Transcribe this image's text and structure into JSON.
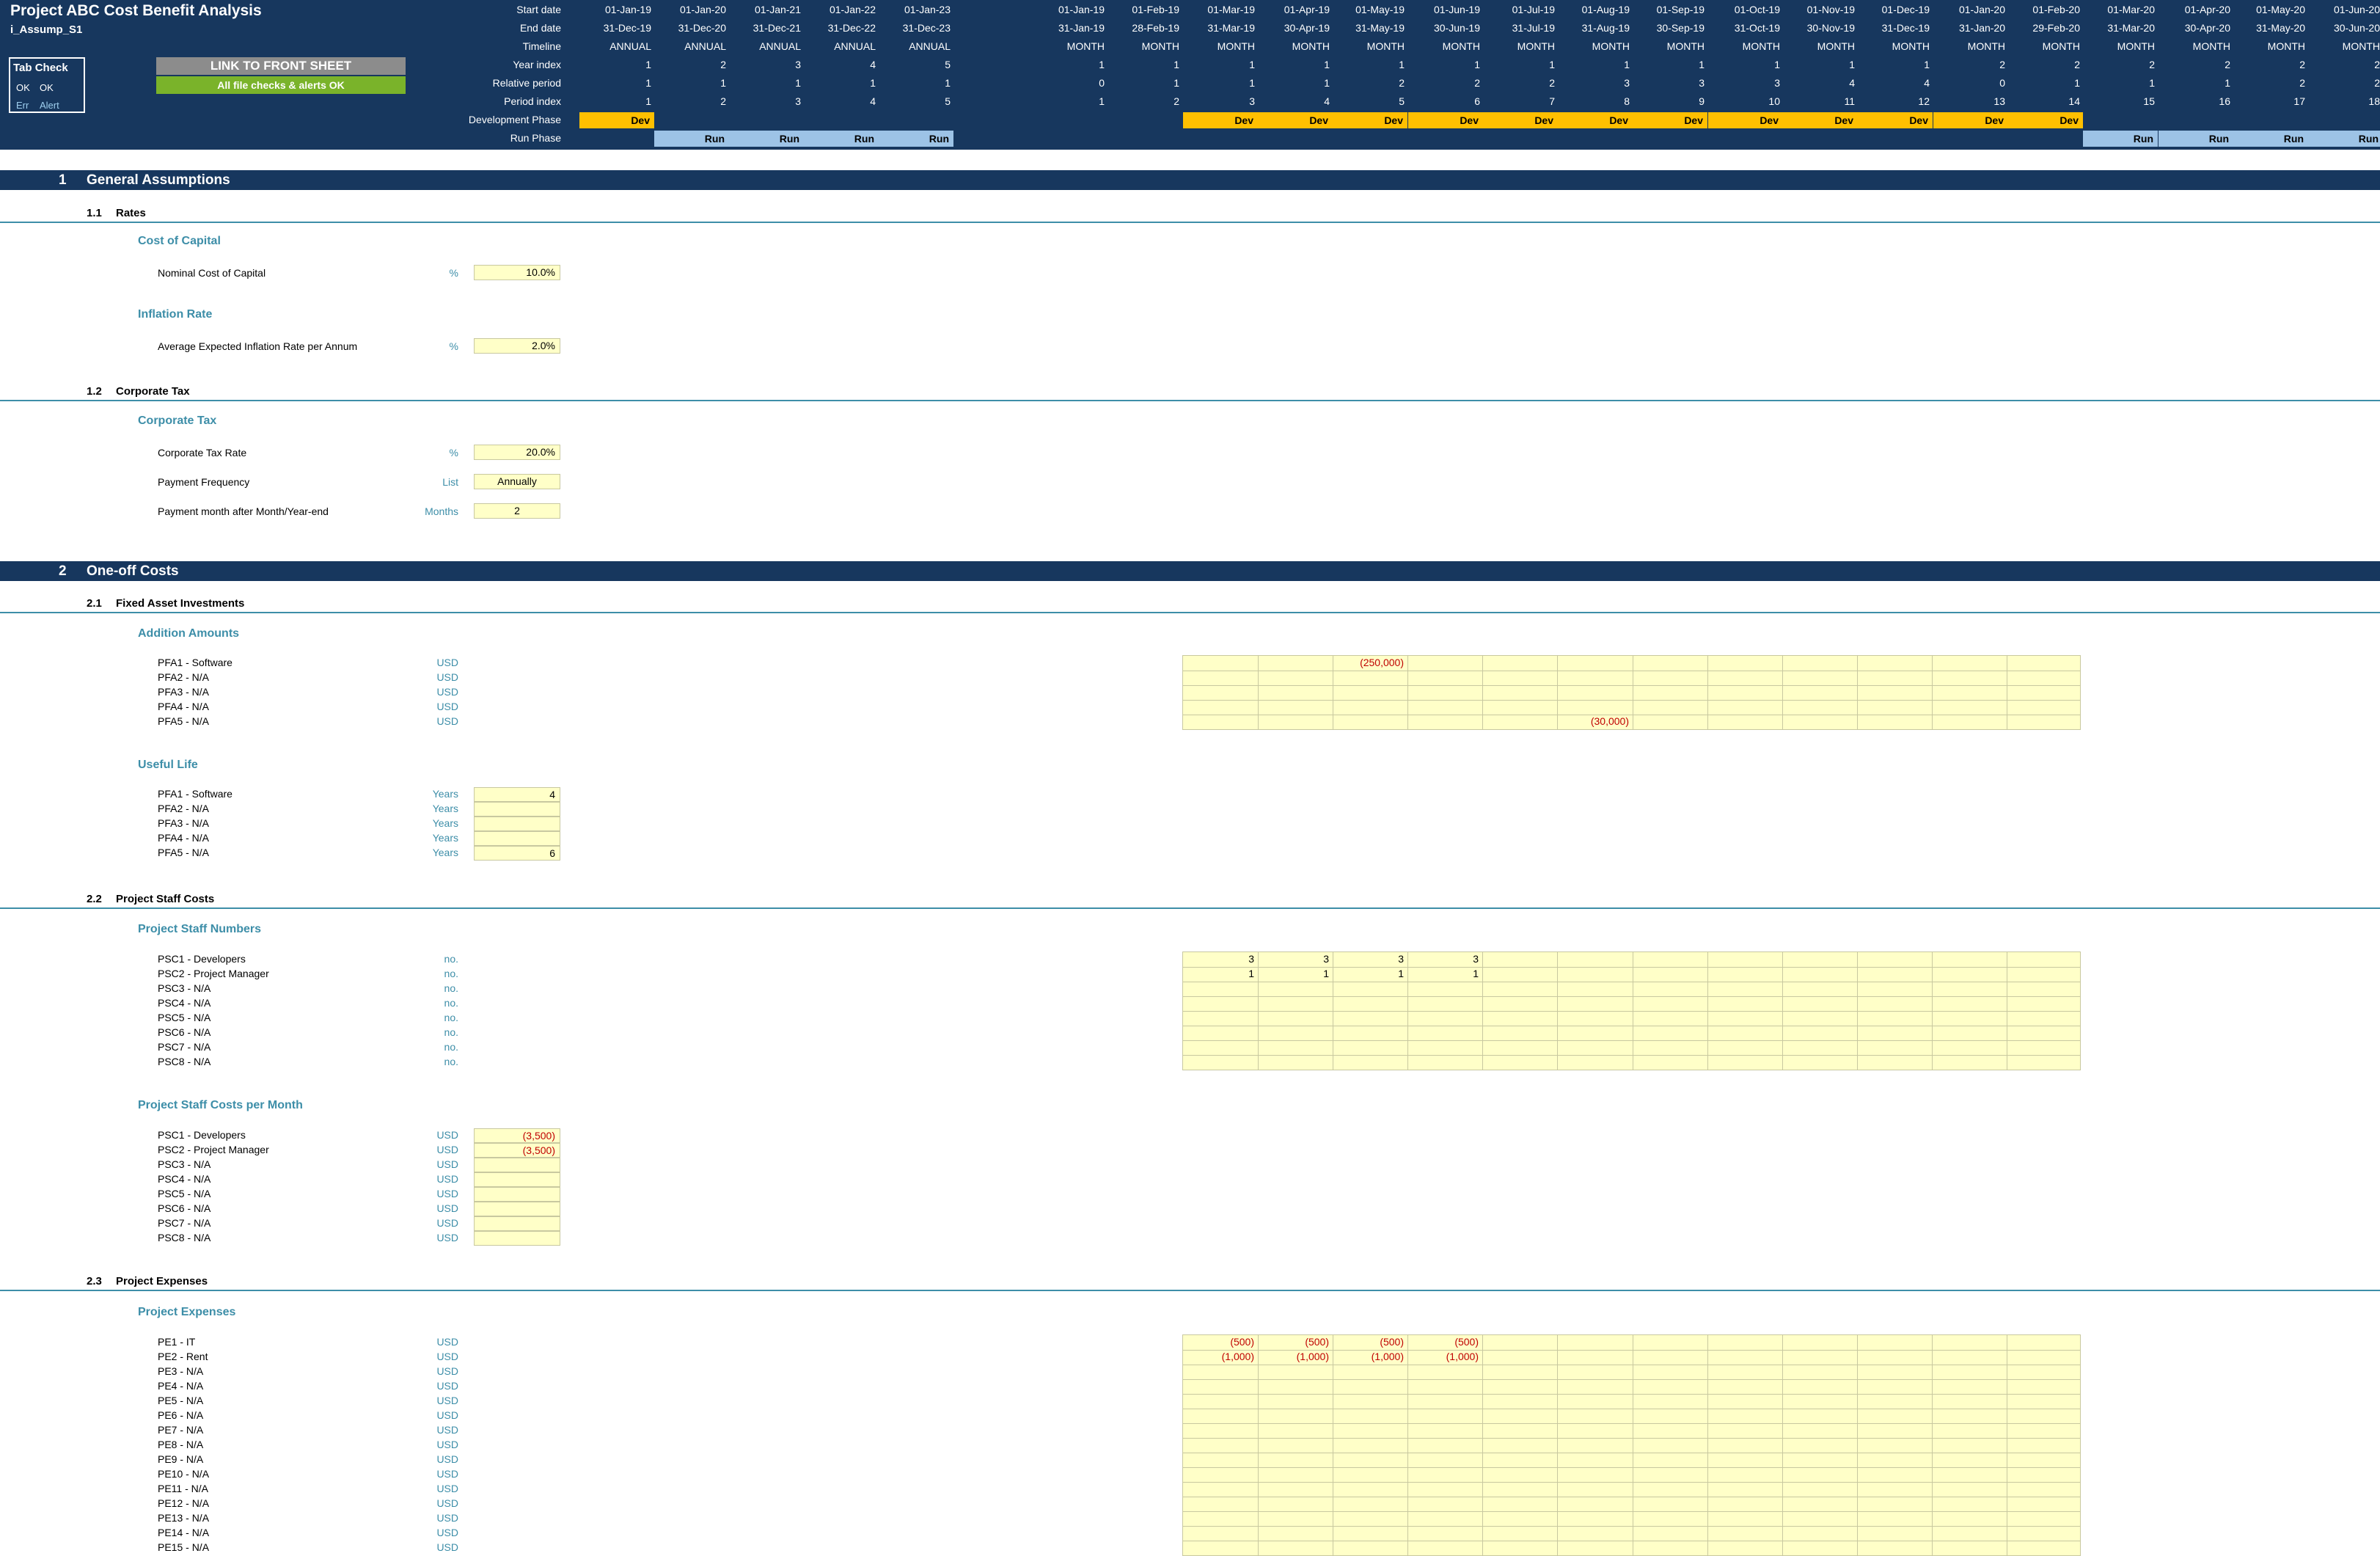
{
  "header": {
    "title": "Project ABC Cost Benefit Analysis",
    "sheet_name": "i_Assump_S1",
    "tab_check": {
      "title": "Tab Check",
      "ok1": "OK",
      "ok2": "OK",
      "err": "Err",
      "alert": "Alert"
    },
    "link_button": "LINK TO FRONT SHEET",
    "checks_status": "All file checks & alerts OK",
    "row_labels": {
      "start_date": "Start date",
      "end_date": "End date",
      "timeline": "Timeline",
      "year_index": "Year index",
      "relative_period": "Relative period",
      "period_index": "Period index",
      "development_phase": "Development Phase",
      "run_phase": "Run Phase"
    },
    "annual_columns": [
      {
        "start": "01-Jan-19",
        "end": "31-Dec-19",
        "timeline": "ANNUAL",
        "year_index": "1",
        "relative": "1",
        "period": "1",
        "dev": "Dev",
        "run": ""
      },
      {
        "start": "01-Jan-20",
        "end": "31-Dec-20",
        "timeline": "ANNUAL",
        "year_index": "2",
        "relative": "1",
        "period": "2",
        "dev": "",
        "run": "Run"
      },
      {
        "start": "01-Jan-21",
        "end": "31-Dec-21",
        "timeline": "ANNUAL",
        "year_index": "3",
        "relative": "1",
        "period": "3",
        "dev": "",
        "run": "Run"
      },
      {
        "start": "01-Jan-22",
        "end": "31-Dec-22",
        "timeline": "ANNUAL",
        "year_index": "4",
        "relative": "1",
        "period": "4",
        "dev": "",
        "run": "Run"
      },
      {
        "start": "01-Jan-23",
        "end": "31-Dec-23",
        "timeline": "ANNUAL",
        "year_index": "5",
        "relative": "1",
        "period": "5",
        "dev": "",
        "run": "Run"
      }
    ],
    "monthly_columns": [
      {
        "start": "01-Jan-19",
        "end": "31-Jan-19",
        "timeline": "MONTH",
        "year_index": "1",
        "relative": "0",
        "period": "1",
        "dev": "",
        "run": ""
      },
      {
        "start": "01-Feb-19",
        "end": "28-Feb-19",
        "timeline": "MONTH",
        "year_index": "1",
        "relative": "1",
        "period": "2",
        "dev": "",
        "run": ""
      },
      {
        "start": "01-Mar-19",
        "end": "31-Mar-19",
        "timeline": "MONTH",
        "year_index": "1",
        "relative": "1",
        "period": "3",
        "dev": "Dev",
        "run": ""
      },
      {
        "start": "01-Apr-19",
        "end": "30-Apr-19",
        "timeline": "MONTH",
        "year_index": "1",
        "relative": "1",
        "period": "4",
        "dev": "Dev",
        "run": ""
      },
      {
        "start": "01-May-19",
        "end": "31-May-19",
        "timeline": "MONTH",
        "year_index": "1",
        "relative": "2",
        "period": "5",
        "dev": "Dev",
        "run": ""
      },
      {
        "start": "01-Jun-19",
        "end": "30-Jun-19",
        "timeline": "MONTH",
        "year_index": "1",
        "relative": "2",
        "period": "6",
        "dev": "Dev",
        "run": ""
      },
      {
        "start": "01-Jul-19",
        "end": "31-Jul-19",
        "timeline": "MONTH",
        "year_index": "1",
        "relative": "2",
        "period": "7",
        "dev": "Dev",
        "run": ""
      },
      {
        "start": "01-Aug-19",
        "end": "31-Aug-19",
        "timeline": "MONTH",
        "year_index": "1",
        "relative": "3",
        "period": "8",
        "dev": "Dev",
        "run": ""
      },
      {
        "start": "01-Sep-19",
        "end": "30-Sep-19",
        "timeline": "MONTH",
        "year_index": "1",
        "relative": "3",
        "period": "9",
        "dev": "Dev",
        "run": ""
      },
      {
        "start": "01-Oct-19",
        "end": "31-Oct-19",
        "timeline": "MONTH",
        "year_index": "1",
        "relative": "3",
        "period": "10",
        "dev": "Dev",
        "run": ""
      },
      {
        "start": "01-Nov-19",
        "end": "30-Nov-19",
        "timeline": "MONTH",
        "year_index": "1",
        "relative": "4",
        "period": "11",
        "dev": "Dev",
        "run": ""
      },
      {
        "start": "01-Dec-19",
        "end": "31-Dec-19",
        "timeline": "MONTH",
        "year_index": "1",
        "relative": "4",
        "period": "12",
        "dev": "Dev",
        "run": ""
      },
      {
        "start": "01-Jan-20",
        "end": "31-Jan-20",
        "timeline": "MONTH",
        "year_index": "2",
        "relative": "0",
        "period": "13",
        "dev": "Dev",
        "run": ""
      },
      {
        "start": "01-Feb-20",
        "end": "29-Feb-20",
        "timeline": "MONTH",
        "year_index": "2",
        "relative": "1",
        "period": "14",
        "dev": "Dev",
        "run": ""
      },
      {
        "start": "01-Mar-20",
        "end": "31-Mar-20",
        "timeline": "MONTH",
        "year_index": "2",
        "relative": "1",
        "period": "15",
        "dev": "",
        "run": "Run"
      },
      {
        "start": "01-Apr-20",
        "end": "30-Apr-20",
        "timeline": "MONTH",
        "year_index": "2",
        "relative": "1",
        "period": "16",
        "dev": "",
        "run": "Run"
      },
      {
        "start": "01-May-20",
        "end": "31-May-20",
        "timeline": "MONTH",
        "year_index": "2",
        "relative": "2",
        "period": "17",
        "dev": "",
        "run": "Run"
      },
      {
        "start": "01-Jun-20",
        "end": "30-Jun-20",
        "timeline": "MONTH",
        "year_index": "2",
        "relative": "2",
        "period": "18",
        "dev": "",
        "run": "Run"
      }
    ]
  },
  "sections": {
    "s1": {
      "num": "1",
      "title": "General Assumptions"
    },
    "s1_1": {
      "num": "1.1",
      "title": "Rates"
    },
    "cost_of_capital": {
      "group": "Cost of Capital",
      "label": "Nominal Cost of Capital",
      "unit": "%",
      "value": "10.0%"
    },
    "inflation": {
      "group": "Inflation Rate",
      "label": "Average Expected Inflation Rate per Annum",
      "unit": "%",
      "value": "2.0%"
    },
    "s1_2": {
      "num": "1.2",
      "title": "Corporate Tax"
    },
    "corp_tax": {
      "group": "Corporate Tax",
      "rate_label": "Corporate Tax Rate",
      "rate_unit": "%",
      "rate_value": "20.0%",
      "freq_label": "Payment Frequency",
      "freq_unit": "List",
      "freq_value": "Annually",
      "month_label": "Payment month after Month/Year-end",
      "month_unit": "Months",
      "month_value": "2"
    },
    "s2": {
      "num": "2",
      "title": "One-off Costs"
    },
    "s2_1": {
      "num": "2.1",
      "title": "Fixed Asset Investments"
    },
    "addition_amounts": {
      "group": "Addition Amounts",
      "unit": "USD",
      "rows": [
        {
          "label": "PFA1 - Software",
          "values": [
            "",
            "",
            "(250,000)",
            "",
            "",
            "",
            "",
            "",
            "",
            "",
            "",
            ""
          ]
        },
        {
          "label": "PFA2 - N/A",
          "values": [
            "",
            "",
            "",
            "",
            "",
            "",
            "",
            "",
            "",
            "",
            "",
            ""
          ]
        },
        {
          "label": "PFA3 - N/A",
          "values": [
            "",
            "",
            "",
            "",
            "",
            "",
            "",
            "",
            "",
            "",
            "",
            ""
          ]
        },
        {
          "label": "PFA4 - N/A",
          "values": [
            "",
            "",
            "",
            "",
            "",
            "",
            "",
            "",
            "",
            "",
            "",
            ""
          ]
        },
        {
          "label": "PFA5 - N/A",
          "values": [
            "",
            "",
            "",
            "",
            "",
            "(30,000)",
            "",
            "",
            "",
            "",
            "",
            ""
          ]
        }
      ]
    },
    "useful_life": {
      "group": "Useful Life",
      "unit": "Years",
      "rows": [
        {
          "label": "PFA1 - Software",
          "value": "4"
        },
        {
          "label": "PFA2 - N/A",
          "value": ""
        },
        {
          "label": "PFA3 - N/A",
          "value": ""
        },
        {
          "label": "PFA4 - N/A",
          "value": ""
        },
        {
          "label": "PFA5 - N/A",
          "value": "6"
        }
      ]
    },
    "s2_2": {
      "num": "2.2",
      "title": "Project Staff Costs"
    },
    "staff_numbers": {
      "group": "Project Staff Numbers",
      "unit": "no.",
      "rows": [
        {
          "label": "PSC1 - Developers",
          "values": [
            "3",
            "3",
            "3",
            "3",
            "",
            "",
            "",
            "",
            "",
            "",
            "",
            ""
          ]
        },
        {
          "label": "PSC2 - Project Manager",
          "values": [
            "1",
            "1",
            "1",
            "1",
            "",
            "",
            "",
            "",
            "",
            "",
            "",
            ""
          ]
        },
        {
          "label": "PSC3 - N/A",
          "values": [
            "",
            "",
            "",
            "",
            "",
            "",
            "",
            "",
            "",
            "",
            "",
            ""
          ]
        },
        {
          "label": "PSC4 - N/A",
          "values": [
            "",
            "",
            "",
            "",
            "",
            "",
            "",
            "",
            "",
            "",
            "",
            ""
          ]
        },
        {
          "label": "PSC5 - N/A",
          "values": [
            "",
            "",
            "",
            "",
            "",
            "",
            "",
            "",
            "",
            "",
            "",
            ""
          ]
        },
        {
          "label": "PSC6 - N/A",
          "values": [
            "",
            "",
            "",
            "",
            "",
            "",
            "",
            "",
            "",
            "",
            "",
            ""
          ]
        },
        {
          "label": "PSC7 - N/A",
          "values": [
            "",
            "",
            "",
            "",
            "",
            "",
            "",
            "",
            "",
            "",
            "",
            ""
          ]
        },
        {
          "label": "PSC8 - N/A",
          "values": [
            "",
            "",
            "",
            "",
            "",
            "",
            "",
            "",
            "",
            "",
            "",
            ""
          ]
        }
      ]
    },
    "staff_costs": {
      "group": "Project Staff Costs per Month",
      "unit": "USD",
      "rows": [
        {
          "label": "PSC1 - Developers",
          "value": "(3,500)"
        },
        {
          "label": "PSC2 - Project Manager",
          "value": "(3,500)"
        },
        {
          "label": "PSC3 - N/A",
          "value": ""
        },
        {
          "label": "PSC4 - N/A",
          "value": ""
        },
        {
          "label": "PSC5 - N/A",
          "value": ""
        },
        {
          "label": "PSC6 - N/A",
          "value": ""
        },
        {
          "label": "PSC7 - N/A",
          "value": ""
        },
        {
          "label": "PSC8 - N/A",
          "value": ""
        }
      ]
    },
    "s2_3": {
      "num": "2.3",
      "title": "Project Expenses"
    },
    "expenses": {
      "group": "Project Expenses",
      "unit": "USD",
      "rows": [
        {
          "label": "PE1 - IT",
          "values": [
            "(500)",
            "(500)",
            "(500)",
            "(500)",
            "",
            "",
            "",
            "",
            "",
            "",
            "",
            ""
          ]
        },
        {
          "label": "PE2 - Rent",
          "values": [
            "(1,000)",
            "(1,000)",
            "(1,000)",
            "(1,000)",
            "",
            "",
            "",
            "",
            "",
            "",
            "",
            ""
          ]
        },
        {
          "label": "PE3 - N/A",
          "values": []
        },
        {
          "label": "PE4 - N/A",
          "values": []
        },
        {
          "label": "PE5 - N/A",
          "values": []
        },
        {
          "label": "PE6 - N/A",
          "values": []
        },
        {
          "label": "PE7 - N/A",
          "values": []
        },
        {
          "label": "PE8 - N/A",
          "values": []
        },
        {
          "label": "PE9 - N/A",
          "values": []
        },
        {
          "label": "PE10 - N/A",
          "values": []
        },
        {
          "label": "PE11 - N/A",
          "values": []
        },
        {
          "label": "PE12 - N/A",
          "values": []
        },
        {
          "label": "PE13 - N/A",
          "values": []
        },
        {
          "label": "PE14 - N/A",
          "values": []
        },
        {
          "label": "PE15 - N/A",
          "values": []
        }
      ]
    }
  },
  "colors": {
    "header_bg": "#17375e",
    "dev_phase": "#ffc000",
    "run_phase": "#9dc3e6",
    "input_cell": "#ffffc8",
    "accent": "#3d8ea8",
    "negative": "#c00000",
    "checks_ok": "#7ab32a"
  }
}
